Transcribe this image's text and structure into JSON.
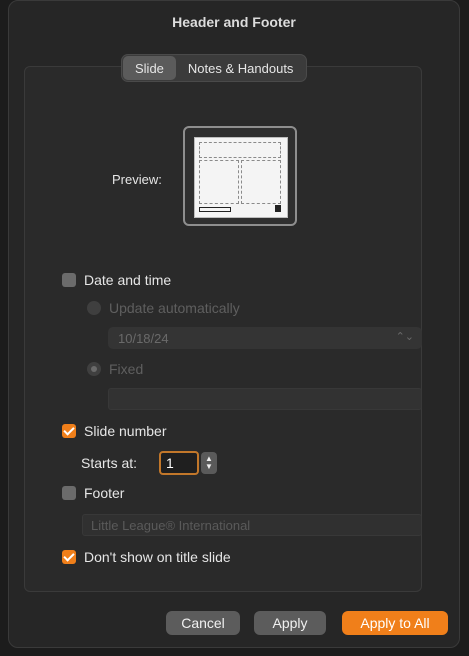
{
  "window": {
    "title": "Header and Footer"
  },
  "tabs": [
    {
      "label": "Slide",
      "active": true
    },
    {
      "label": "Notes & Handouts",
      "active": false
    }
  ],
  "preview": {
    "label": "Preview:"
  },
  "date_time": {
    "label": "Date and time",
    "checked": false,
    "update_automatically_label": "Update automatically",
    "date_value": "10/18/24",
    "fixed_label": "Fixed",
    "fixed_value": ""
  },
  "slide_number": {
    "label": "Slide number",
    "checked": true,
    "starts_at_label": "Starts at:",
    "starts_at_value": "1"
  },
  "footer": {
    "label": "Footer",
    "checked": false,
    "value": "Little League® International"
  },
  "dont_show_title": {
    "label": "Don't show on title slide",
    "checked": true
  },
  "buttons": {
    "cancel": "Cancel",
    "apply": "Apply",
    "apply_all": "Apply to All"
  },
  "colors": {
    "accent": "#f07f1a",
    "background": "#262626"
  }
}
